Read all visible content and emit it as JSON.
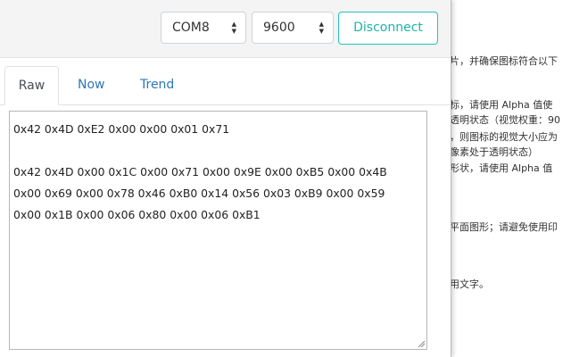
{
  "background_doc": {
    "lines": [
      "片，并确保图标符合以下",
      "标，请使用 Alpha 值使",
      "透明状态（视觉权重：90",
      "，则图标的视觉大小应为",
      "像素处于透明状态）",
      "形状，请使用 Alpha 值",
      "平面图形；请避免使用印",
      "用文字。"
    ]
  },
  "toolbar": {
    "port_value": "COM8",
    "baud_value": "9600",
    "disconnect_label": "Disconnect"
  },
  "tabs": {
    "raw": "Raw",
    "now": "Now",
    "trend": "Trend"
  },
  "raw_output": {
    "lines": [
      "0x42 0x4D 0xE2 0x00 0x00 0x01 0x71",
      "",
      "0x42 0x4D 0x00 0x1C 0x00 0x71 0x00 0x9E 0x00 0xB5 0x00 0x4B",
      "0x00 0x69 0x00 0x78 0x46 0xB0 0x14 0x56 0x03 0xB9 0x00 0x59",
      "0x00 0x1B 0x00 0x06 0x80 0x00 0x06 0xB1"
    ]
  },
  "colors": {
    "accent": "#1cb6a8",
    "tab_link": "#2f77b9"
  }
}
